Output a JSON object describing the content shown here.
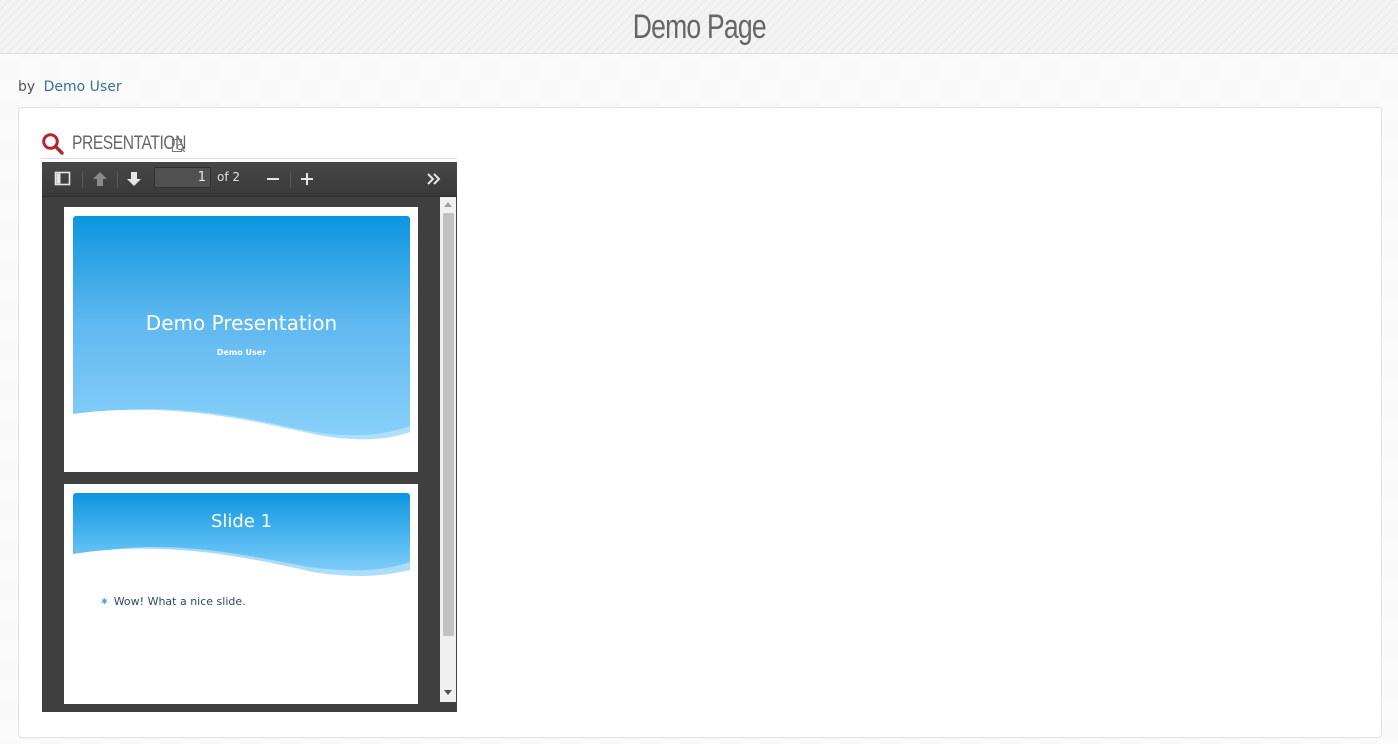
{
  "page": {
    "title": "Demo Page"
  },
  "byline": {
    "prefix": "by",
    "author": "Demo User"
  },
  "section": {
    "title": "PRESENTATION"
  },
  "viewer": {
    "current_page": "1",
    "page_count_label": "of 2",
    "slides": [
      {
        "title": "Demo Presentation",
        "subtitle": "Demo User"
      },
      {
        "title": "Slide 1",
        "bullets": [
          "Wow! What a nice slide."
        ]
      }
    ]
  },
  "colors": {
    "accent_red": "#b3262e",
    "link_blue": "#3a6f9a",
    "slide_blue": "#0d95e0",
    "toolbar_dark": "#404040"
  },
  "icons": {
    "section": "search-icon",
    "preview": "preview-icon",
    "sidebar_toggle": "sidebar-toggle-icon",
    "prev": "arrow-up-icon",
    "next": "arrow-down-icon",
    "zoom_out": "minus-icon",
    "zoom_in": "plus-icon",
    "tools": "double-chevron-right-icon"
  }
}
